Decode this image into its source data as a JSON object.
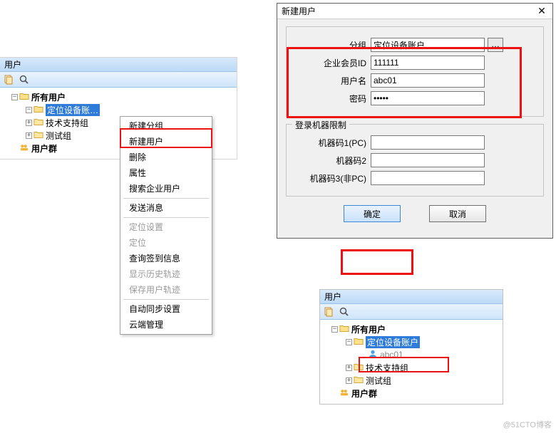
{
  "left_panel": {
    "title": "用户",
    "toolbar": {
      "copy_icon": "copy-icon",
      "search_icon": "search-icon"
    },
    "tree": {
      "root": {
        "label": "所有用户",
        "expand": "−"
      },
      "node1": {
        "label": "定位设备账…",
        "expand": "−",
        "selected": true
      },
      "node2": {
        "label": "技术支持组",
        "expand": "+"
      },
      "node3": {
        "label": "测试组",
        "expand": "+"
      },
      "group": {
        "label": "用户群"
      }
    }
  },
  "context_menu": {
    "items": {
      "new_group": "新建分组",
      "new_user": "新建用户",
      "delete": "删除",
      "properties": "属性",
      "search_user": "搜索企业用户",
      "send_msg": "发送消息",
      "loc_settings": "定位设置",
      "locate": "定位",
      "query_sign": "查询签到信息",
      "show_track": "显示历史轨迹",
      "save_track": "保存用户轨迹",
      "auto_sync": "自动同步设置",
      "cloud_mgmt": "云端管理"
    }
  },
  "dialog": {
    "title": "新建用户",
    "group_label": "分组",
    "group_value": "定位设备账户",
    "browse_label": "…",
    "member_id_label": "企业会员ID",
    "member_id_value": "111111",
    "username_label": "用户名",
    "username_value": "abc01",
    "password_label": "密码",
    "password_value": "•••••",
    "legend_restrict": "登录机器限制",
    "machine1_label": "机器码1(PC)",
    "machine1_value": "",
    "machine2_label": "机器码2",
    "machine2_value": "",
    "machine3_label": "机器码3(非PC)",
    "machine3_value": "",
    "ok": "确定",
    "cancel": "取消"
  },
  "small_panel": {
    "title": "用户",
    "tree": {
      "root": {
        "label": "所有用户",
        "expand": "−"
      },
      "node1": {
        "label": "定位设备账户",
        "expand": "−",
        "selected": true
      },
      "leaf": {
        "label": "abc01"
      },
      "node2": {
        "label": "技术支持组",
        "expand": "+"
      },
      "node3": {
        "label": "测试组",
        "expand": "+"
      },
      "group": {
        "label": "用户群"
      }
    }
  },
  "watermark": "@51CTO博客"
}
